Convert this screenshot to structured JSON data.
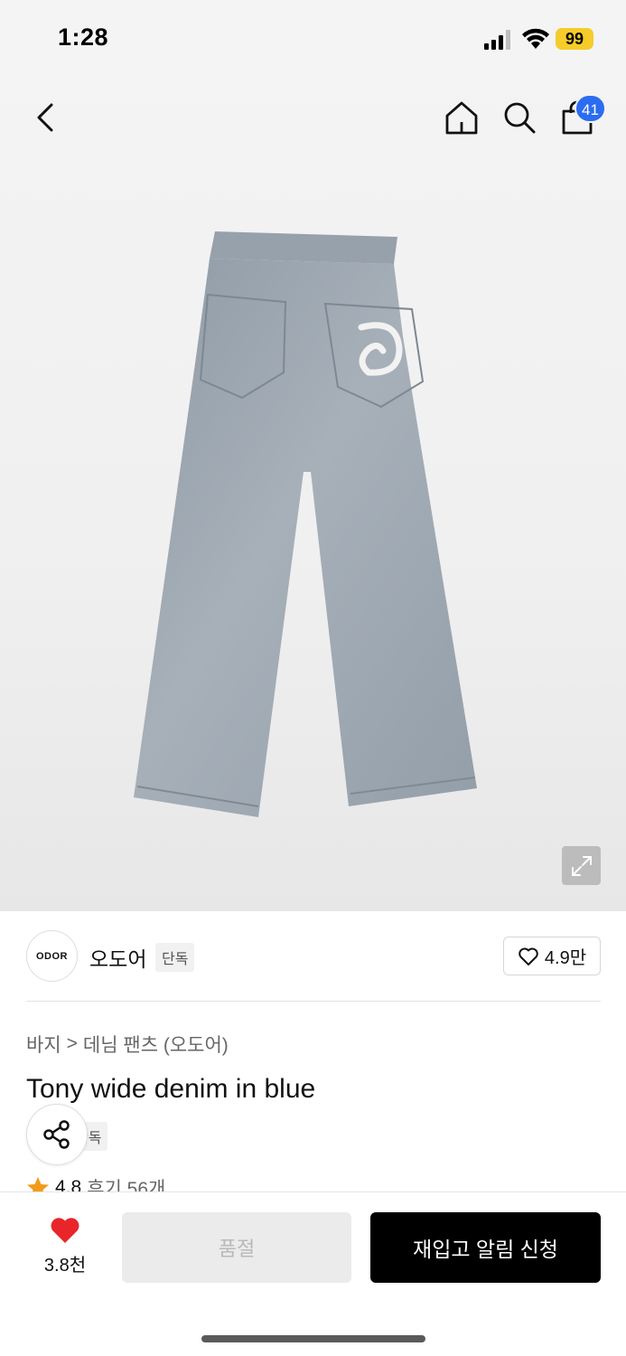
{
  "status_bar": {
    "time": "1:28",
    "battery": "99"
  },
  "nav": {
    "cart_count": "41"
  },
  "brand": {
    "logo_text": "ODOR",
    "name": "오도어",
    "tag": "단독",
    "likes": "4.9만"
  },
  "breadcrumb": {
    "category": "바지",
    "separator": ">",
    "subcategory": "데님 팬츠 (오도어)"
  },
  "product": {
    "title": "Tony wide denim in blue",
    "tag": "단독",
    "rating": "4.8",
    "reviews": "후기 56개"
  },
  "bottom_bar": {
    "like_count": "3.8천",
    "soldout_label": "품절",
    "restock_label": "재입고 알림 신청"
  },
  "colors": {
    "accent_blue": "#2b6cf0",
    "battery_yellow": "#f5cc2a",
    "heart_red": "#e8262a",
    "star_orange": "#f29b1b",
    "cta_black": "#000000"
  }
}
